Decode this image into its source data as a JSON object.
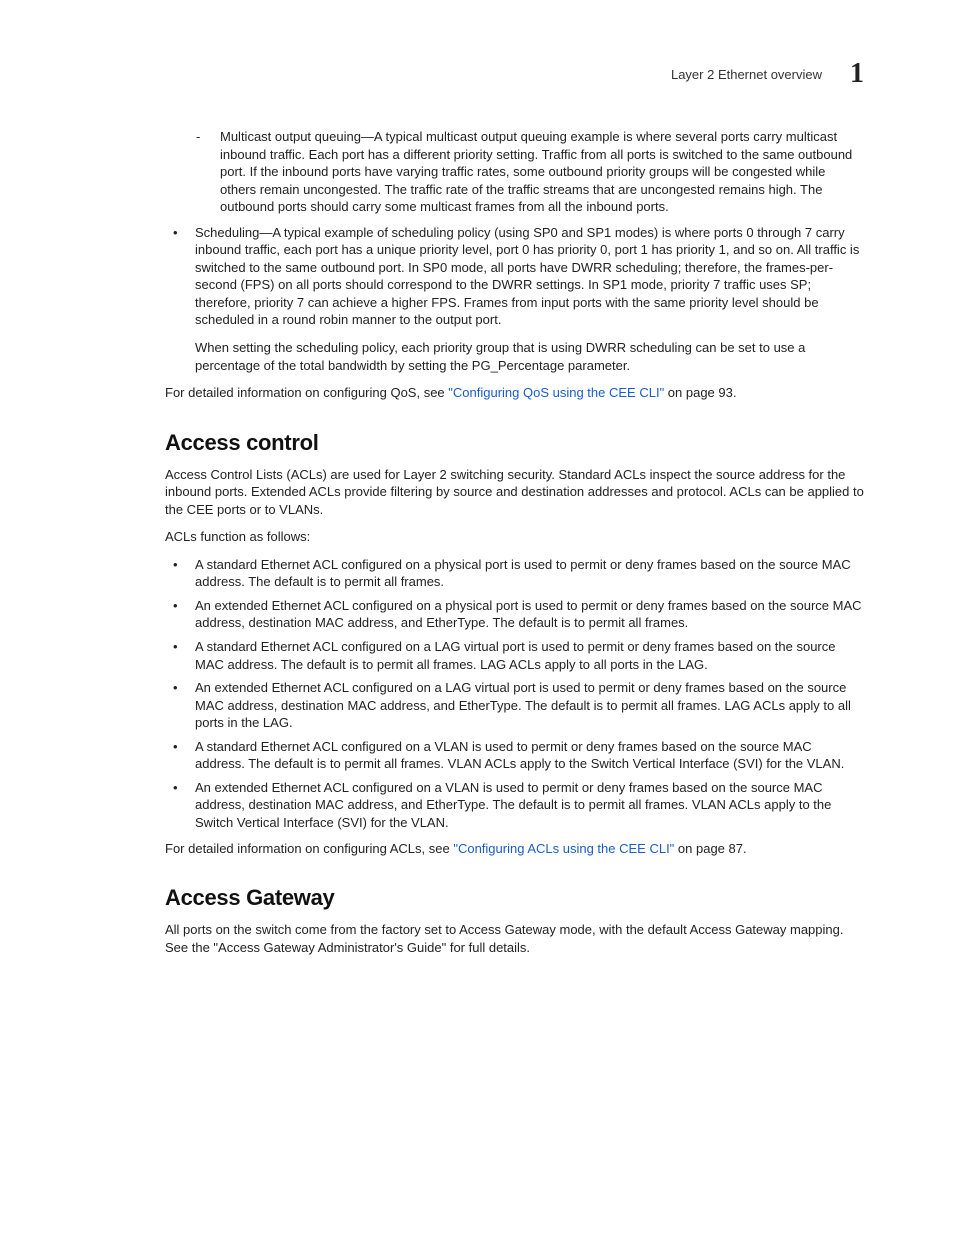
{
  "header": {
    "title": "Layer 2 Ethernet overview",
    "chapter": "1"
  },
  "top_dash": {
    "text": "Multicast output queuing—A typical multicast output queuing example is where several ports carry multicast inbound traffic. Each port has a different priority setting. Traffic from all ports is switched to the same outbound port. If the inbound ports have varying traffic rates, some outbound priority groups will be congested while others remain uncongested. The traffic rate of the traffic streams that are uncongested remains high. The outbound ports should carry some multicast frames from all the inbound ports."
  },
  "sched_bullet": {
    "p1": "Scheduling—A typical example of scheduling policy (using SP0 and SP1 modes) is where ports 0 through 7 carry inbound traffic, each port has a unique priority level, port 0 has priority 0, port 1 has priority 1, and so on. All traffic is switched to the same outbound port. In SP0 mode, all ports have DWRR scheduling; therefore, the frames-per-second (FPS) on all ports should correspond to the DWRR settings. In SP1 mode, priority 7 traffic uses SP; therefore, priority 7 can achieve a higher FPS. Frames from input ports with the same priority level should be scheduled in a round robin manner to the output port.",
    "p2": "When setting the scheduling policy, each priority group that is using DWRR scheduling can be set to use a percentage of the total bandwidth by setting the PG_Percentage parameter."
  },
  "qos_ref": {
    "pre": "For detailed information on configuring QoS, see ",
    "link": "\"Configuring QoS using the CEE CLI\"",
    "post": " on page 93."
  },
  "acl": {
    "heading": "Access control",
    "intro": "Access Control Lists (ACLs) are used for Layer 2 switching security. Standard ACLs inspect the source address for the inbound ports. Extended ACLs provide filtering by source and destination addresses and protocol. ACLs can be applied to the CEE ports or to VLANs.",
    "lead": "ACLs function as follows:",
    "items": [
      "A standard Ethernet ACL configured on a physical port is used to permit or deny frames based on the source MAC address. The default is to permit all frames.",
      "An extended Ethernet ACL configured on a physical port is used to permit or deny frames based on the source MAC address, destination MAC address, and EtherType. The default is to permit all frames.",
      "A standard Ethernet ACL configured on a LAG virtual port is used to permit or deny frames based on the source MAC address. The default is to permit all frames. LAG ACLs apply to all ports in the LAG.",
      "An extended Ethernet ACL configured on a LAG virtual port is used to permit or deny frames based on the source MAC address, destination MAC address, and EtherType. The default is to permit all frames. LAG ACLs apply to all ports in the LAG.",
      "A standard Ethernet ACL configured on a VLAN is used to permit or deny frames based on the source MAC address. The default is to permit all frames. VLAN ACLs apply to the Switch Vertical Interface (SVI) for the VLAN.",
      "An extended Ethernet ACL configured on a VLAN is used to permit or deny frames based on the source MAC address, destination MAC address, and EtherType. The default is to permit all frames. VLAN ACLs apply to the Switch Vertical Interface (SVI) for the VLAN."
    ],
    "ref_pre": "For detailed information on configuring ACLs, see ",
    "ref_link": "\"Configuring ACLs using the CEE CLI\"",
    "ref_post": " on page 87."
  },
  "ag": {
    "heading": "Access Gateway",
    "body": "All ports on the switch come from the factory set to Access Gateway mode, with the default Access Gateway mapping. See the \"Access Gateway Administrator's Guide\" for full details."
  }
}
